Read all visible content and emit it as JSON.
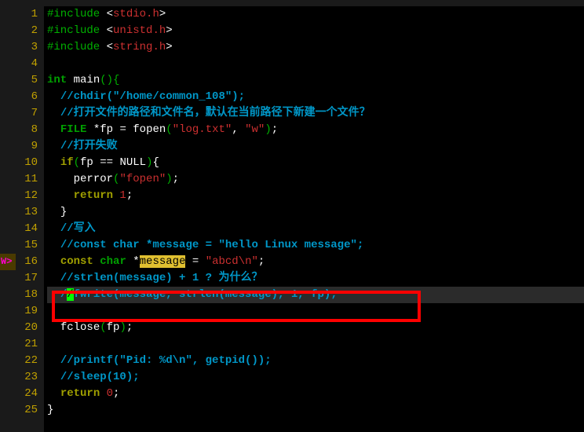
{
  "title_bar": "",
  "gutter": {
    "mark_line": 16,
    "mark_text": "W>"
  },
  "line_start": 1,
  "line_end": 25,
  "current_line": 18,
  "red_box_line": 18,
  "code": [
    [
      [
        "pp",
        "#include "
      ],
      [
        "punc",
        "<"
      ],
      [
        "str",
        "stdio.h"
      ],
      [
        "punc",
        ">"
      ]
    ],
    [
      [
        "pp",
        "#include "
      ],
      [
        "punc",
        "<"
      ],
      [
        "str",
        "unistd.h"
      ],
      [
        "punc",
        ">"
      ]
    ],
    [
      [
        "pp",
        "#include "
      ],
      [
        "punc",
        "<"
      ],
      [
        "str",
        "string.h"
      ],
      [
        "punc",
        ">"
      ]
    ],
    [],
    [
      [
        "type",
        "int "
      ],
      [
        "id",
        "main"
      ],
      [
        "paren",
        "(){"
      ]
    ],
    [
      [
        "id",
        "  "
      ],
      [
        "cmt",
        "//chdir(\"/home/common_108\");"
      ]
    ],
    [
      [
        "id",
        "  "
      ],
      [
        "cmt",
        "//打开文件的路径和文件名，默认在当前路径下新建一个文件？"
      ]
    ],
    [
      [
        "id",
        "  "
      ],
      [
        "type",
        "FILE "
      ],
      [
        "punc",
        "*"
      ],
      [
        "id",
        "fp "
      ],
      [
        "punc",
        "= "
      ],
      [
        "id",
        "fopen"
      ],
      [
        "paren",
        "("
      ],
      [
        "str",
        "\"log.txt\""
      ],
      [
        "punc",
        ", "
      ],
      [
        "str",
        "\"w\""
      ],
      [
        "paren",
        ")"
      ],
      [
        "punc",
        ";"
      ]
    ],
    [
      [
        "id",
        "  "
      ],
      [
        "cmt",
        "//打开失败"
      ]
    ],
    [
      [
        "id",
        "  "
      ],
      [
        "kw",
        "if"
      ],
      [
        "paren",
        "("
      ],
      [
        "id",
        "fp "
      ],
      [
        "punc",
        "== "
      ],
      [
        "id",
        "NULL"
      ],
      [
        "paren",
        ")"
      ],
      [
        "punc",
        "{"
      ]
    ],
    [
      [
        "id",
        "    "
      ],
      [
        "id",
        "perror"
      ],
      [
        "paren",
        "("
      ],
      [
        "str",
        "\"fopen\""
      ],
      [
        "paren",
        ")"
      ],
      [
        "punc",
        ";"
      ]
    ],
    [
      [
        "id",
        "    "
      ],
      [
        "kw",
        "return "
      ],
      [
        "num",
        "1"
      ],
      [
        "punc",
        ";"
      ]
    ],
    [
      [
        "id",
        "  "
      ],
      [
        "punc",
        "}"
      ]
    ],
    [
      [
        "id",
        "  "
      ],
      [
        "cmt",
        "//写入"
      ]
    ],
    [
      [
        "id",
        "  "
      ],
      [
        "cmt",
        "//const char *message = \"hello Linux message\";"
      ]
    ],
    [
      [
        "id",
        "  "
      ],
      [
        "kw",
        "const "
      ],
      [
        "type",
        "char "
      ],
      [
        "punc",
        "*"
      ],
      [
        "hl",
        "message"
      ],
      [
        "id",
        " "
      ],
      [
        "punc",
        "= "
      ],
      [
        "str",
        "\"abcd\\n\""
      ],
      [
        "punc",
        ";"
      ]
    ],
    [
      [
        "id",
        "  "
      ],
      [
        "cmt",
        "//strlen(message) + 1 ? 为什么？"
      ]
    ],
    [
      [
        "id",
        "  "
      ],
      [
        "cmt",
        "/"
      ],
      [
        "cursor",
        "/"
      ],
      [
        "cmt",
        "fwrite(message, strlen(message), 1, fp);"
      ]
    ],
    [],
    [
      [
        "id",
        "  "
      ],
      [
        "id",
        "fclose"
      ],
      [
        "paren",
        "("
      ],
      [
        "id",
        "fp"
      ],
      [
        "paren",
        ")"
      ],
      [
        "punc",
        ";"
      ]
    ],
    [],
    [
      [
        "id",
        "  "
      ],
      [
        "cmt",
        "//printf(\"Pid: %d\\n\", getpid());"
      ]
    ],
    [
      [
        "id",
        "  "
      ],
      [
        "cmt",
        "//sleep(10);"
      ]
    ],
    [
      [
        "id",
        "  "
      ],
      [
        "kw",
        "return "
      ],
      [
        "num",
        "0"
      ],
      [
        "punc",
        ";"
      ]
    ],
    [
      [
        "punc",
        "}"
      ]
    ]
  ]
}
